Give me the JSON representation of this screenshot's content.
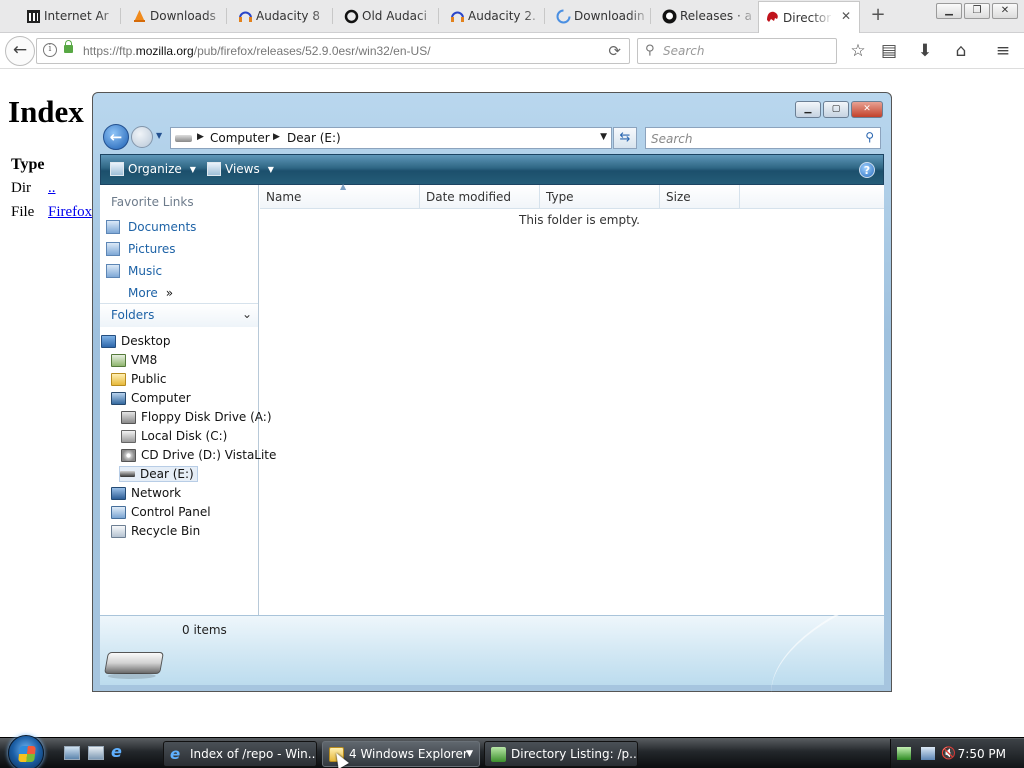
{
  "browser": {
    "tabs": [
      {
        "label": "Internet Ar",
        "icon": "archive-icon"
      },
      {
        "label": "Downloads",
        "icon": "vlc-icon"
      },
      {
        "label": "Audacity 8",
        "icon": "audacity-icon"
      },
      {
        "label": "Old Audaci",
        "icon": "oldversion-icon"
      },
      {
        "label": "Audacity 2.",
        "icon": "audacity-icon"
      },
      {
        "label": "Downloadin",
        "icon": "loading-icon"
      },
      {
        "label": "Releases · a",
        "icon": "github-icon"
      },
      {
        "label": "Director",
        "icon": "mozilla-icon",
        "active": true
      }
    ],
    "new_tab_symbol": "+",
    "url_prefix": "https://ftp.",
    "url_domain": "mozilla.org",
    "url_path": "/pub/firefox/releases/52.9.0esr/win32/en-US/",
    "search_placeholder": "Search"
  },
  "page": {
    "heading": "Index",
    "col_type": "Type",
    "rows": [
      {
        "type": "Dir",
        "link": ".."
      },
      {
        "type": "File",
        "link": "Firefox"
      }
    ]
  },
  "explorer": {
    "breadcrumb": [
      "Computer",
      "Dear (E:)"
    ],
    "search_placeholder": "Search",
    "toolbar": {
      "organize": "Organize",
      "views": "Views"
    },
    "favorite_links_heading": "Favorite Links",
    "favorites": [
      "Documents",
      "Pictures",
      "Music"
    ],
    "more_label": "More",
    "folders_label": "Folders",
    "tree": [
      {
        "label": "Desktop",
        "icon": "desktop-icon"
      },
      {
        "label": "VM8",
        "icon": "vm-icon"
      },
      {
        "label": "Public",
        "icon": "folder-icon"
      },
      {
        "label": "Computer",
        "icon": "computer-icon"
      },
      {
        "label": "Floppy Disk Drive (A:)",
        "icon": "floppy-icon"
      },
      {
        "label": "Local Disk (C:)",
        "icon": "disk-icon"
      },
      {
        "label": "CD Drive (D:) VistaLite",
        "icon": "cd-icon"
      },
      {
        "label": "Dear (E:)",
        "icon": "usb-drive-icon",
        "selected": true
      },
      {
        "label": "Network",
        "icon": "network-icon"
      },
      {
        "label": "Control Panel",
        "icon": "control-panel-icon"
      },
      {
        "label": "Recycle Bin",
        "icon": "recycle-bin-icon"
      }
    ],
    "columns": [
      "Name",
      "Date modified",
      "Type",
      "Size"
    ],
    "empty_message": "This folder is empty.",
    "item_count": "0 items"
  },
  "taskbar": {
    "buttons": [
      {
        "label": "Index of /repo - Win...",
        "icon": "ie-icon"
      },
      {
        "label": "4 Windows Explorer",
        "icon": "folder-icon",
        "active": true
      },
      {
        "label": "Directory Listing: /p...",
        "icon": "download-icon"
      }
    ],
    "clock": "7:50 PM"
  },
  "colors": {
    "cmdbar": "#245c78",
    "link": "#1d62a6",
    "taskbar": "#23272b"
  }
}
